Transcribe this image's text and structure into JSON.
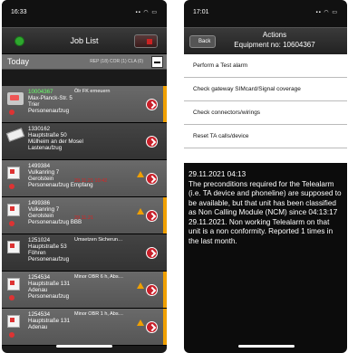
{
  "left": {
    "status_time": "16:33",
    "status_icons": "▪▪ ◠ ▭",
    "title": "Job List",
    "today": "Today",
    "counts": "REP (18)  COR (1)  CLA (0)",
    "rows": [
      {
        "id": "10004367",
        "l1": "Max-Planck-Str. 5",
        "l2": "Trier",
        "l3": "Personenaufzug",
        "note": "Ölr FK erneuern",
        "date": ""
      },
      {
        "id": "1330162",
        "l1": "Hauptstraße 50",
        "l2": "Mülheim an der Mosel",
        "l3": "Lastenaufzug",
        "note": "",
        "date": ""
      },
      {
        "id": "1499384",
        "l1": "Vulkanring 7",
        "l2": "Gerolstein",
        "l3": "Personenaufzug Empfang",
        "note": "",
        "date": "29.11.21 10:42"
      },
      {
        "id": "1499386",
        "l1": "Vulkanring 7",
        "l2": "Gerolstein",
        "l3": "Personenaufzug BBB",
        "note": "",
        "date": "29.11.21"
      },
      {
        "id": "1251024",
        "l1": "Hauptstraße 53",
        "l2": "Föhren",
        "l3": "Personenaufzug",
        "note": "Umsetzen Sicherun…",
        "date": ""
      },
      {
        "id": "1254534",
        "l1": "Hauptstraße 131",
        "l2": "Adenau",
        "l3": "Personenaufzug",
        "note": "Minor OBR 6 h, Abs…",
        "date": ""
      },
      {
        "id": "1254534",
        "l1": "Hauptstraße 131",
        "l2": "Adenau",
        "l3": "",
        "note": "Minor OBR 1 h, Abs…",
        "date": ""
      }
    ]
  },
  "right": {
    "status_time": "17:01",
    "status_icons": "▪▪ ◠ ▭",
    "back": "Back",
    "title": "Actions",
    "subtitle": "Equipment no: 10604367",
    "actions": [
      "Perform a Test alarm",
      "Check gateway SIMcard/Signal coverage",
      "Check connectors/wirings",
      "Reset TA calls/device"
    ],
    "message_date": "29.11.2021 04:13",
    "message": "The preconditions required for the Telealarm (i.e. TA device and phoneline) are supposed to be available, but that unit has been classified as Non Calling Module (NCM) since 04:13:17 29.11.2021. Non working Telealarm on that unit is a non conformity. Reported 1 times in the last month."
  },
  "colors": {
    "accent_red": "#c8202a",
    "flag_orange": "#f0a000",
    "header_dark": "#2a2a2a"
  }
}
